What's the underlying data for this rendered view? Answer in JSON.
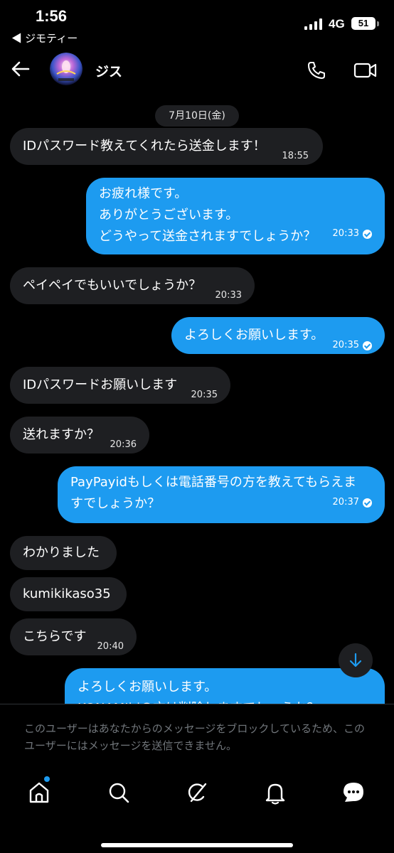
{
  "status_bar": {
    "time": "1:56",
    "back_app": "◀ ジモティー",
    "network": "4G",
    "battery": "51"
  },
  "header": {
    "contact_name": "ジス"
  },
  "chat": {
    "date": "7月10日(金)",
    "messages": [
      {
        "dir": "in",
        "lines": [
          "IDパスワード教えてくれたら送金します！"
        ],
        "time": "18:55"
      },
      {
        "dir": "out",
        "lines": [
          "お疲れ様です。",
          "ありがとうございます。",
          "どうやって送金されますでしょうか？"
        ],
        "time": "20:33"
      },
      {
        "dir": "in",
        "lines": [
          "ペイペイでもいいでしょうか？"
        ],
        "time": "20:33"
      },
      {
        "dir": "out",
        "lines": [
          "よろしくお願いします。"
        ],
        "time": "20:35"
      },
      {
        "dir": "in",
        "lines": [
          "IDパスワードお願いします"
        ],
        "time": "20:35"
      },
      {
        "dir": "in",
        "lines": [
          "送れますか？"
        ],
        "time": "20:36"
      },
      {
        "dir": "out",
        "lines": [
          "PayPayidもしくは電話番号の方を教えてもらえま",
          "すでしょうか？"
        ],
        "time": "20:37"
      },
      {
        "dir": "in",
        "lines": [
          "わかりました"
        ],
        "time": ""
      },
      {
        "dir": "in",
        "lines": [
          "kumikikaso35"
        ],
        "time": ""
      },
      {
        "dir": "in",
        "lines": [
          "こちらです"
        ],
        "time": "20:40"
      },
      {
        "dir": "out",
        "lines": [
          "よろしくお願いします。",
          "KONAMIidの方は削除しますでしょうか？"
        ],
        "time": ""
      }
    ]
  },
  "blocked_notice": "このユーザーはあなたからのメッセージをブロックしているため、このユーザーにはメッセージを送信できません。",
  "tabs": [
    "home",
    "search",
    "grok",
    "notifications",
    "messages"
  ],
  "colors": {
    "accent": "#1d9bf0",
    "incoming_bubble": "#1e1f22",
    "background": "#000000",
    "muted_text": "#71767b"
  }
}
